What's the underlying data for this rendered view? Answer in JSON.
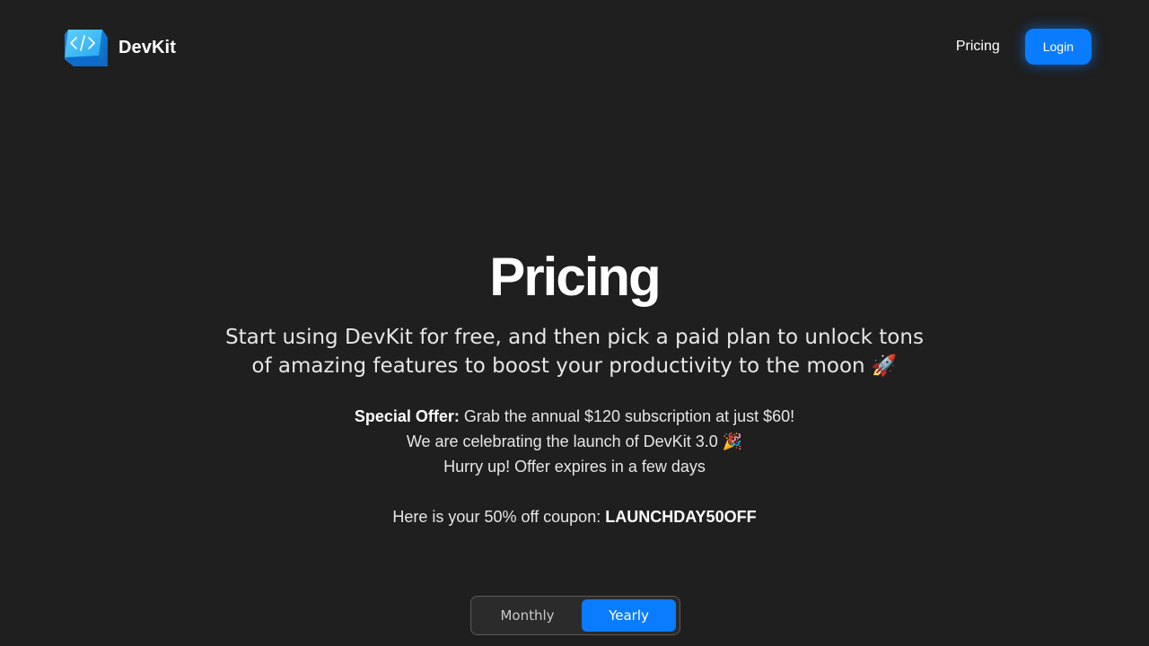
{
  "header": {
    "brand_name": "DevKit",
    "logo_icon": "code-cube-icon",
    "nav_pricing": "Pricing",
    "login_label": "Login"
  },
  "hero": {
    "title": "Pricing",
    "subtitle": "Start using DevKit for free, and then pick a paid plan to unlock tons of amazing features to boost your productivity to the moon 🚀",
    "offer": {
      "label": "Special Offer:",
      "line1_text": " Grab the annual $120 subscription at just $60!",
      "line2": "We are celebrating the launch of DevKit 3.0 🎉",
      "line3": "Hurry up! Offer expires in a few days"
    },
    "coupon": {
      "prefix": "Here is your 50% off coupon: ",
      "code": "LAUNCHDAY50OFF"
    }
  },
  "billing_toggle": {
    "options": [
      "Monthly",
      "Yearly"
    ],
    "selected": "Yearly"
  },
  "colors": {
    "background": "#1f1f1f",
    "accent": "#0a7cff"
  }
}
